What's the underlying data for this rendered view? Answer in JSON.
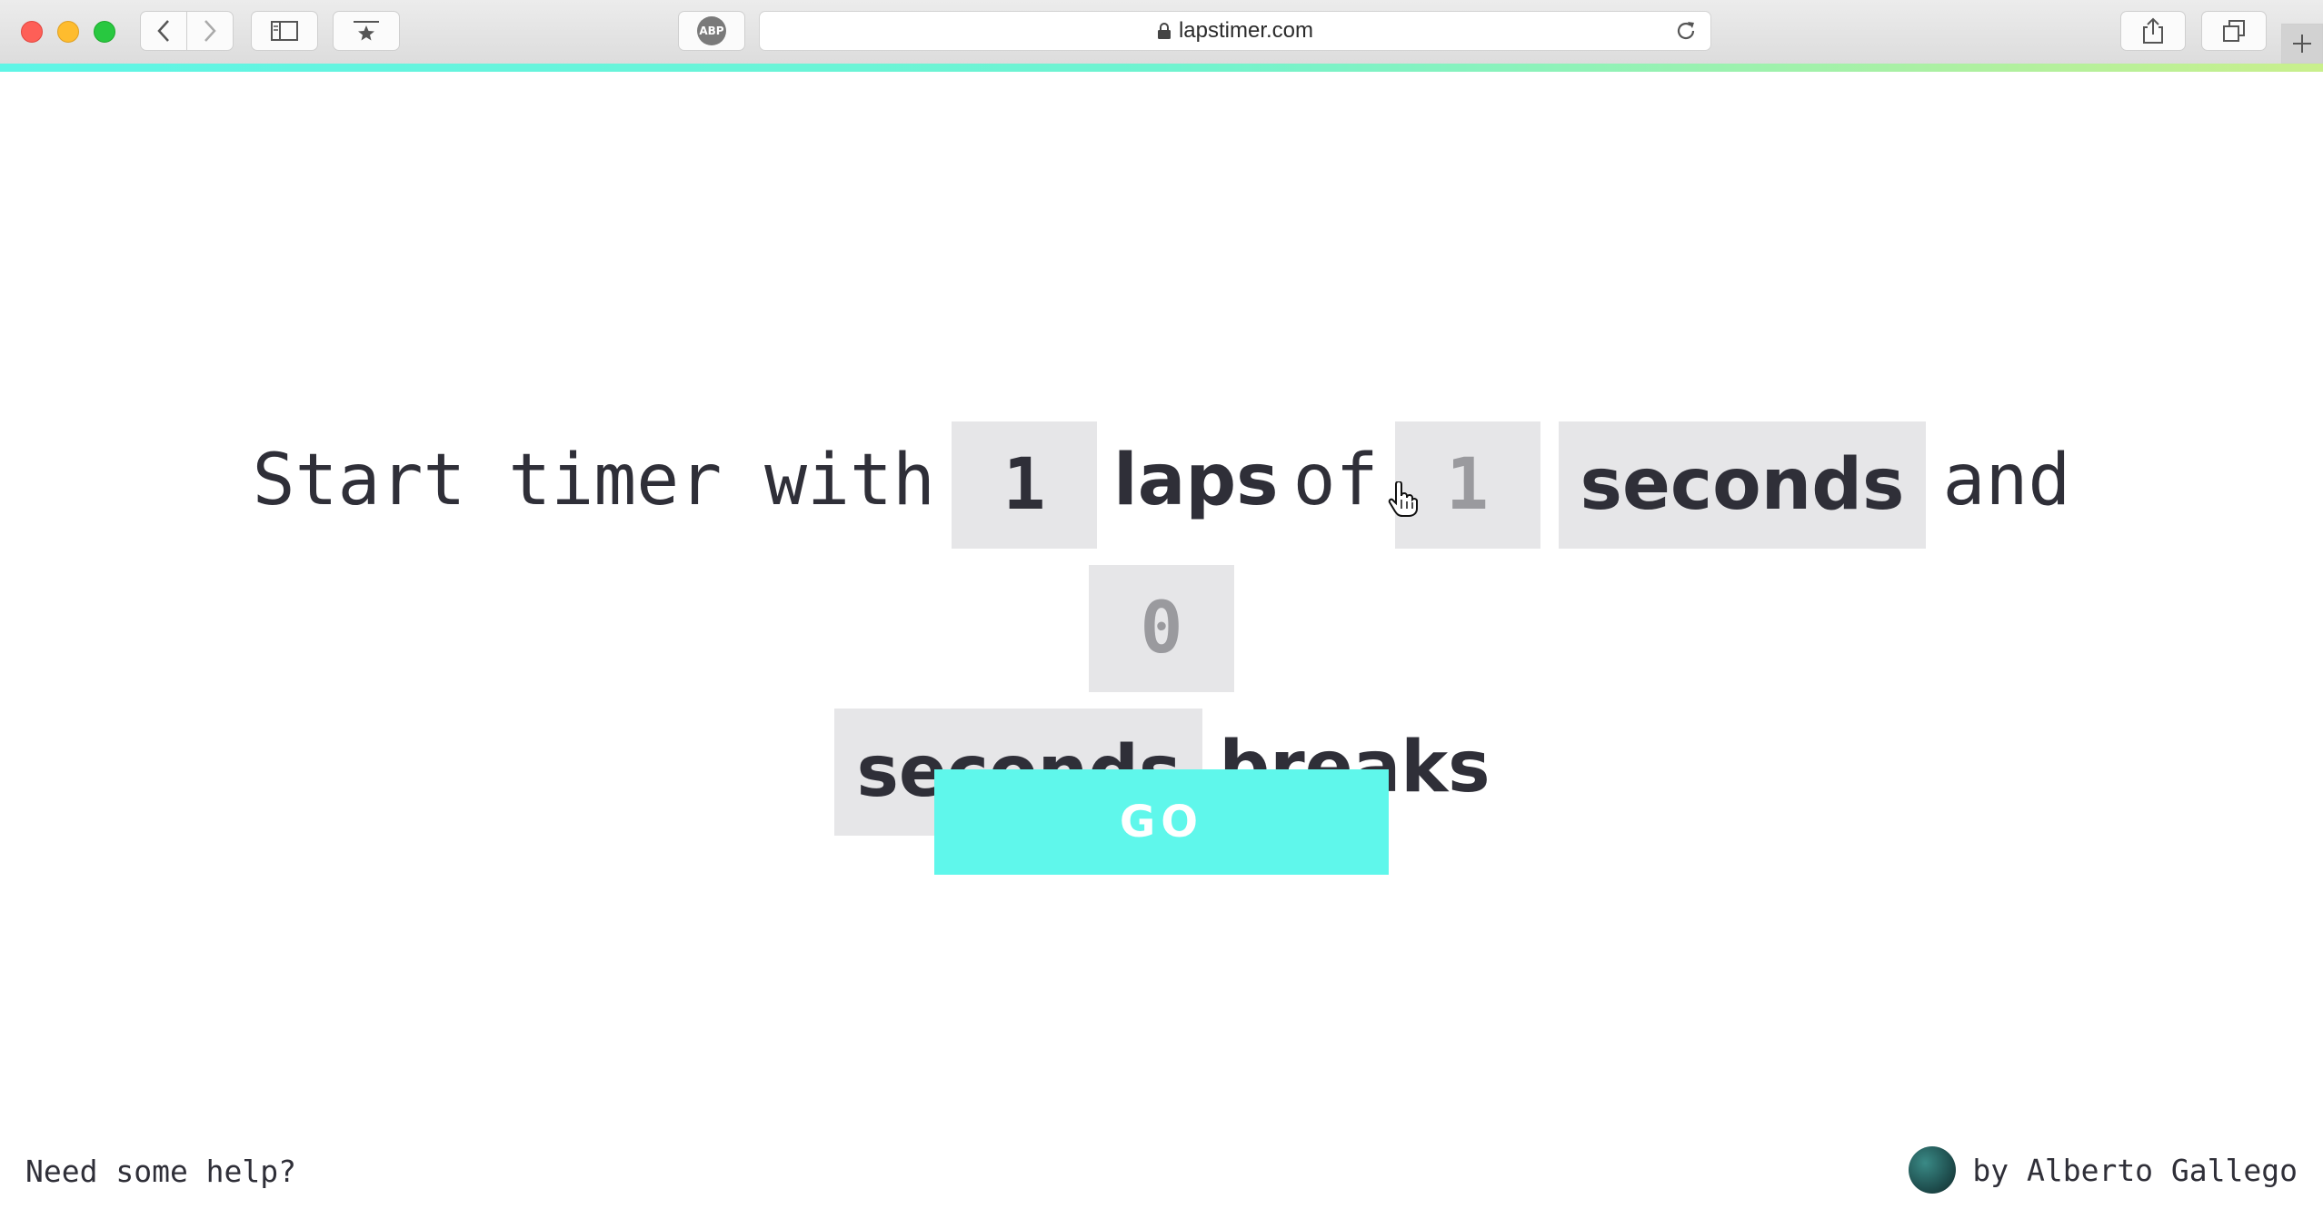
{
  "browser": {
    "url": "lapstimer.com",
    "adblock_label": "ABP"
  },
  "timer_form": {
    "prefix": "Start timer with",
    "laps_value": "1",
    "laps_label": "laps",
    "of_label": "of",
    "lap_duration_value": "1",
    "lap_unit": "seconds",
    "and_label": "and",
    "break_value": "0",
    "break_unit": "seconds",
    "breaks_label": "breaks"
  },
  "go_button": "GO",
  "footer": {
    "help": "Need some help?",
    "author": "by Alberto Gallego"
  },
  "colors": {
    "accent": "#5ff7eb",
    "field_bg": "#e6e6e8",
    "text": "#2f2f38"
  }
}
